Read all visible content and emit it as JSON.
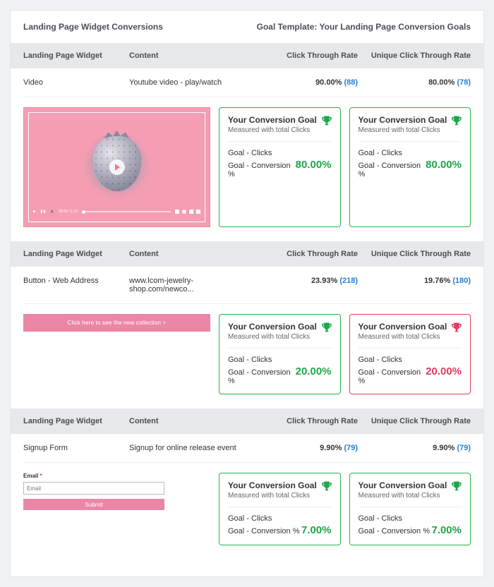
{
  "header": {
    "title": "Landing Page Widget Conversions",
    "goal_template": "Goal Template: Your Landing Page Conversion Goals"
  },
  "columns": {
    "widget": "Landing Page Widget",
    "content": "Content",
    "ctr": "Click Through Rate",
    "uctr": "Unique Click Through Rate"
  },
  "goal_card_labels": {
    "title": "Your Conversion Goal",
    "subtitle": "Measured with total Clicks",
    "row1": "Goal - Clicks",
    "row2": "Goal - Conversion %"
  },
  "signup_preview": {
    "label": "Email",
    "required_mark": "*",
    "placeholder": "Email",
    "submit": "Submit"
  },
  "banner_preview": {
    "text": "Click here to see the new collection >"
  },
  "sections": [
    {
      "widget": "Video",
      "content": "Youtube video - play/watch",
      "ctr_pct": "90.00%",
      "ctr_count": "(88)",
      "uctr_pct": "80.00%",
      "uctr_count": "(78)",
      "goal_left": {
        "pct": "80.00%",
        "color": "green",
        "border": "green"
      },
      "goal_right": {
        "pct": "80.00%",
        "color": "green",
        "border": "green"
      },
      "preview": "video"
    },
    {
      "widget": "Button - Web Address",
      "content": "www.lcom-jewelry-shop.com/newco...",
      "ctr_pct": "23.93%",
      "ctr_count": "(218)",
      "uctr_pct": "19.76%",
      "uctr_count": "(180)",
      "goal_left": {
        "pct": "20.00%",
        "color": "green",
        "border": "green"
      },
      "goal_right": {
        "pct": "20.00%",
        "color": "red",
        "border": "red"
      },
      "preview": "banner"
    },
    {
      "widget": "Signup Form",
      "content": "Signup for online release event",
      "ctr_pct": "9.90%",
      "ctr_count": "(79)",
      "uctr_pct": "9.90%",
      "uctr_count": "(79)",
      "goal_left": {
        "pct": "7.00%",
        "color": "green",
        "border": "green"
      },
      "goal_right": {
        "pct": "7.00%",
        "color": "green",
        "border": "green"
      },
      "preview": "signup"
    }
  ],
  "colors": {
    "green": "#1EA64A",
    "red": "#e23b5e",
    "link": "#1F7FD4",
    "pink": "#eb87a5"
  }
}
